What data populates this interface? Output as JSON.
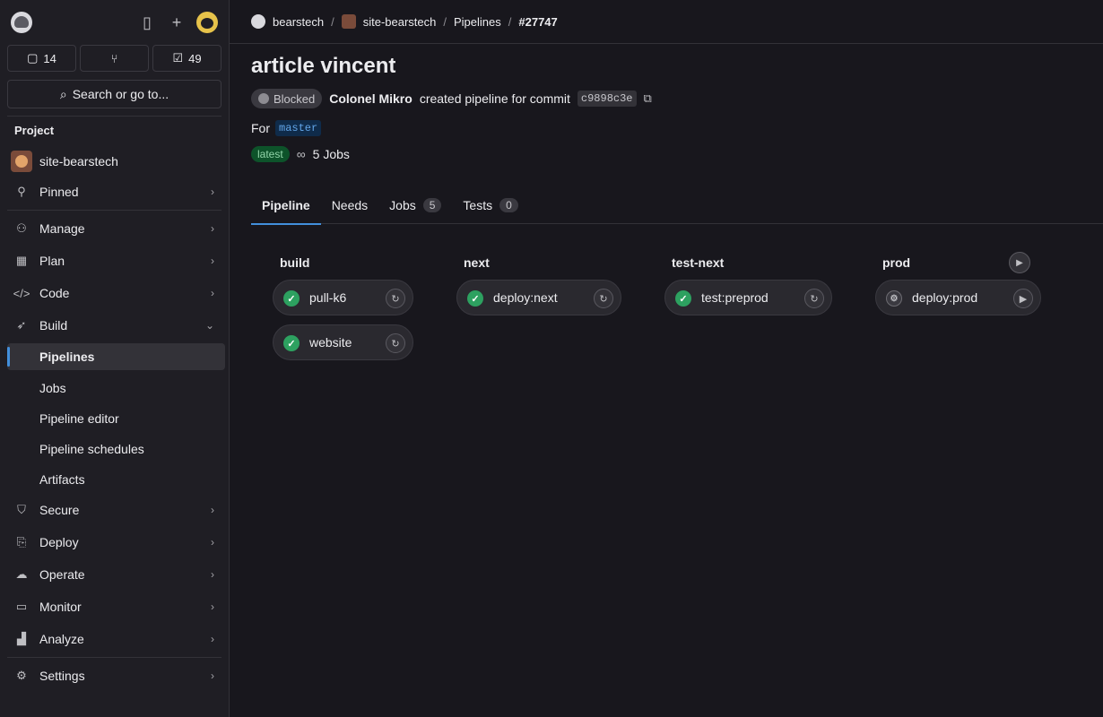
{
  "sidebar": {
    "counters": {
      "issues": "14",
      "merge_requests": "",
      "todos": "49"
    },
    "search_label": "Search or go to...",
    "section_label": "Project",
    "project_name": "site-bearstech",
    "items": [
      {
        "label": "Pinned",
        "icon": "pin-icon"
      },
      {
        "label": "Manage",
        "icon": "users-icon"
      },
      {
        "label": "Plan",
        "icon": "calendar-icon"
      },
      {
        "label": "Code",
        "icon": "code-icon"
      },
      {
        "label": "Build",
        "icon": "rocket-icon"
      },
      {
        "label": "Secure",
        "icon": "shield-icon"
      },
      {
        "label": "Deploy",
        "icon": "deploy-icon"
      },
      {
        "label": "Operate",
        "icon": "cloud-icon"
      },
      {
        "label": "Monitor",
        "icon": "monitor-icon"
      },
      {
        "label": "Analyze",
        "icon": "chart-icon"
      },
      {
        "label": "Settings",
        "icon": "gear-icon"
      }
    ],
    "build_subitems": [
      "Pipelines",
      "Jobs",
      "Pipeline editor",
      "Pipeline schedules",
      "Artifacts"
    ]
  },
  "breadcrumb": {
    "group": "bearstech",
    "project": "site-bearstech",
    "section": "Pipelines",
    "current": "#27747"
  },
  "pipeline": {
    "title": "article vincent",
    "status": "Blocked",
    "author": "Colonel Mikro",
    "action_text": "created pipeline for commit",
    "commit": "c9898c3e",
    "for_label": "For",
    "branch": "master",
    "latest_badge": "latest",
    "jobs_summary": "5 Jobs"
  },
  "tabs": [
    {
      "label": "Pipeline",
      "count": null
    },
    {
      "label": "Needs",
      "count": null
    },
    {
      "label": "Jobs",
      "count": "5"
    },
    {
      "label": "Tests",
      "count": "0"
    }
  ],
  "stages": [
    {
      "name": "build",
      "jobs": [
        "pull-k6",
        "website"
      ]
    },
    {
      "name": "next",
      "jobs": [
        "deploy:next"
      ]
    },
    {
      "name": "test-next",
      "jobs": [
        "test:preprod"
      ]
    },
    {
      "name": "prod",
      "jobs": [
        "deploy:prod"
      ]
    }
  ],
  "colors": {
    "accent": "#428fdc",
    "success": "#2da160",
    "background": "#18171d",
    "sidebar": "#1f1e24"
  }
}
